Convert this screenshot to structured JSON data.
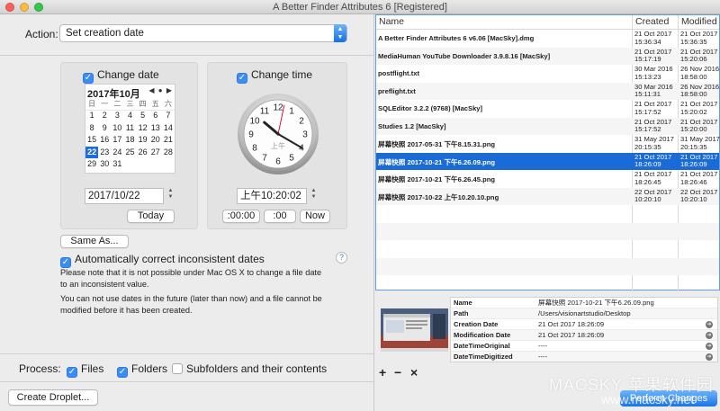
{
  "window": {
    "title": "A Better Finder Attributes 6 [Registered]"
  },
  "action": {
    "label": "Action:",
    "selected": "Set creation date"
  },
  "date": {
    "checkbox_label": "Change date",
    "checked": true,
    "calendar": {
      "month_label": "2017年10月",
      "nav": "◀ ● ▶",
      "weekdays": [
        "日",
        "一",
        "二",
        "三",
        "四",
        "五",
        "六"
      ],
      "leading_blanks": 0,
      "days": [
        1,
        2,
        3,
        4,
        5,
        6,
        7,
        8,
        9,
        10,
        11,
        12,
        13,
        14,
        15,
        16,
        17,
        18,
        19,
        20,
        21,
        22,
        23,
        24,
        25,
        26,
        27,
        28,
        29,
        30,
        31
      ],
      "selected_day": 22
    },
    "value": "2017/10/22",
    "today_button": "Today"
  },
  "time": {
    "checkbox_label": "Change time",
    "checked": true,
    "clock_am_pm": "上午",
    "clock": {
      "hour": 10,
      "minute": 20,
      "second": 2
    },
    "value": "上午10:20:02",
    "btn_reset_minutes": ":00:00",
    "btn_reset_seconds": ":00",
    "btn_now": "Now"
  },
  "same_as_button": "Same As...",
  "auto_correct": {
    "label": "Automatically correct inconsistent dates",
    "checked": true
  },
  "help_glyph": "?",
  "notes": {
    "line1": "Please note that it is not possible under Mac OS X to change a file date to an inconsistent value.",
    "line2": "You can not use dates in the future (later than now) and a file cannot be modified before it has been created."
  },
  "process": {
    "label": "Process:",
    "files": {
      "label": "Files",
      "checked": true
    },
    "folders": {
      "label": "Folders",
      "checked": true
    },
    "subfolders": {
      "label": "Subfolders and their contents",
      "checked": false
    }
  },
  "create_droplet_button": "Create Droplet...",
  "file_table": {
    "headers": {
      "name": "Name",
      "created": "Created",
      "modified": "Modified"
    },
    "rows": [
      {
        "name": "A Better Finder Attributes 6 v6.06 [MacSky].dmg",
        "created": "21 Oct 2017\n15:36:34",
        "modified": "21 Oct 2017\n15:36:35"
      },
      {
        "name": "MediaHuman YouTube Downloader 3.9.8.16 [MacSky]",
        "created": "21 Oct 2017\n15:17:19",
        "modified": "21 Oct 2017\n15:20:06"
      },
      {
        "name": "postflight.txt",
        "created": "30 Mar 2016\n15:13:23",
        "modified": "26 Nov 2016\n18:58:00"
      },
      {
        "name": "preflight.txt",
        "created": "30 Mar 2016\n15:11:31",
        "modified": "26 Nov 2016\n18:58:00"
      },
      {
        "name": "SQLEditor 3.2.2 (9768) [MacSky]",
        "created": "21 Oct 2017\n15:17:52",
        "modified": "21 Oct 2017\n15:20:02"
      },
      {
        "name": "Studies 1.2 [MacSky]",
        "created": "21 Oct 2017\n15:17:52",
        "modified": "21 Oct 2017\n15:20:00"
      },
      {
        "name": "屏幕快照 2017-05-31 下午8.15.31.png",
        "created": "31 May 2017\n20:15:35",
        "modified": "31 May 2017\n20:15:35"
      },
      {
        "name": "屏幕快照 2017-10-21 下午6.26.09.png",
        "created": "21 Oct 2017\n18:26:09",
        "modified": "21 Oct 2017\n18:26:09",
        "selected": true
      },
      {
        "name": "屏幕快照 2017-10-21 下午6.26.45.png",
        "created": "21 Oct 2017\n18:26:45",
        "modified": "21 Oct 2017\n18:26:46"
      },
      {
        "name": "屏幕快照 2017-10-22 上午10.20.10.png",
        "created": "22 Oct 2017\n10:20:10",
        "modified": "22 Oct 2017\n10:20:10"
      }
    ]
  },
  "metadata": [
    {
      "key": "Name",
      "value": "屏幕快照 2017-10-21 下午6.26.09.png",
      "link": false
    },
    {
      "key": "Path",
      "value": "/Users/visionartstudio/Desktop",
      "link": false
    },
    {
      "key": "Creation Date",
      "value": "21 Oct 2017 18:26:09",
      "link": true
    },
    {
      "key": "Modification Date",
      "value": "21 Oct 2017 18:26:09",
      "link": true
    },
    {
      "key": "DateTimeOriginal",
      "value": "----",
      "link": true
    },
    {
      "key": "DateTimeDigitized",
      "value": "----",
      "link": true
    }
  ],
  "list_controls": {
    "add": "+",
    "remove": "−",
    "clear": "×"
  },
  "perform_button": "Perform Changes",
  "watermark": {
    "line1": "MACSKY 苹果软件园",
    "line2": "www.macsky.net"
  },
  "colors": {
    "accent": "#1a6bd6",
    "selection": "#1a6bd6"
  }
}
